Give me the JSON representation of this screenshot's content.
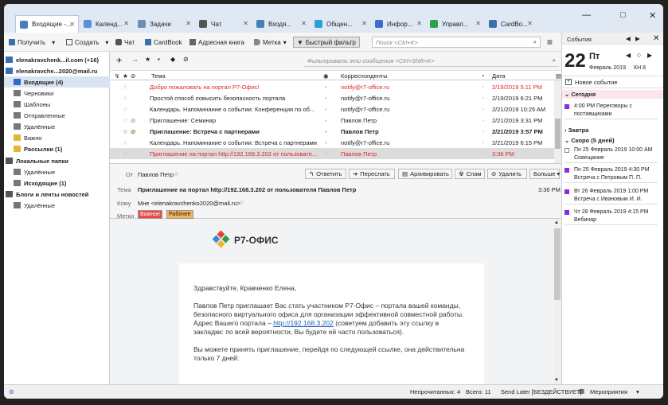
{
  "tabs": [
    {
      "label": "Входящие -...",
      "color": "#4a7ebb"
    },
    {
      "label": "Календ...",
      "color": "#5b8fd6"
    },
    {
      "label": "Задачи",
      "color": "#6d8db3"
    },
    {
      "label": "Чат",
      "color": "#555555"
    },
    {
      "label": "Входя...",
      "color": "#4a7ebb"
    },
    {
      "label": "Общен...",
      "color": "#2aa0d8"
    },
    {
      "label": "Инфор...",
      "color": "#3d6ecf"
    },
    {
      "label": "Управл...",
      "color": "#2e9e4f"
    },
    {
      "label": "CardBo...",
      "color": "#3a6fb0"
    }
  ],
  "window_controls": {
    "minimize": "—",
    "maximize": "□",
    "close": "✕"
  },
  "toolbar": {
    "receive": "Получить",
    "compose": "Создать",
    "chat": "Чат",
    "cardbook": "CardBook",
    "addressbook": "Адресная книга",
    "tag": "Метка",
    "quickfilter": "Быстрый фильтр",
    "search_placeholder": "Поиск <Ctrl+K>"
  },
  "filter_placeholder": "Фильтровать эти сообщения <Ctrl+Shift+K>",
  "folders": [
    {
      "label": "elenakravchenk...il.com (+16)",
      "bold": true
    },
    {
      "label": "elenakravche...2020@mail.ru",
      "bold": true
    },
    {
      "label": "Входящие (4)",
      "bold": true
    },
    {
      "label": "Черновики",
      "bold": false
    },
    {
      "label": "Шаблоны",
      "bold": false
    },
    {
      "label": "Отправленные",
      "bold": false
    },
    {
      "label": "Удалённые",
      "bold": false
    },
    {
      "label": "Важно",
      "bold": false
    },
    {
      "label": "Рассылки (1)",
      "bold": true
    },
    {
      "label": "Локальные папки",
      "bold": true
    },
    {
      "label": "Удалённые",
      "bold": false
    },
    {
      "label": "Исходящие (1)",
      "bold": true
    },
    {
      "label": "Блоги и ленты новостей",
      "bold": true
    },
    {
      "label": "Удалённые",
      "bold": false
    }
  ],
  "list_headers": {
    "subject": "Тема",
    "correspondent": "Корреспонденты",
    "date": "Дата"
  },
  "messages": [
    {
      "subject": "Добро пожаловать на портал Р7-Офис!",
      "from": "notify@r7-office.ru",
      "date": "2/19/2019 5:11 PM",
      "red": true,
      "bold": false,
      "sel": false
    },
    {
      "subject": "Простой способ повысить безопасность портала",
      "from": "notify@r7-office.ru",
      "date": "2/19/2019 6:21 PM",
      "red": false,
      "bold": false,
      "sel": false
    },
    {
      "subject": "Календарь. Напоминание о событии: Конференция по об...",
      "from": "notify@r7-office.ru",
      "date": "2/21/2019 10:25 AM",
      "red": false,
      "bold": false,
      "sel": false
    },
    {
      "subject": "Приглашение: Семинар",
      "from": "Павлов Петр",
      "date": "2/21/2019 3:31 PM",
      "red": false,
      "bold": false,
      "sel": false
    },
    {
      "subject": "Приглашение: Встреча с партнерами",
      "from": "Павлов Петр",
      "date": "2/21/2019 3:57 PM",
      "red": false,
      "bold": true,
      "sel": false
    },
    {
      "subject": "Календарь. Напоминание о событии: Встреча с партнерами",
      "from": "notify@r7-office.ru",
      "date": "2/21/2019 6:15 PM",
      "red": false,
      "bold": false,
      "sel": false
    },
    {
      "subject": "Приглашение на портал http://192.168.3.202 от пользовате...",
      "from": "Павлов Петр",
      "date": "3:36 PM",
      "red": true,
      "bold": false,
      "sel": true
    }
  ],
  "header": {
    "from_label": "От",
    "from": "Павлов Петр",
    "subject_label": "Тема",
    "subject": "Приглашение на портал http://192.168.3.202 от пользователя Павлов Петр",
    "time": "3:36 PM",
    "to_label": "Кому",
    "to": "Мне <elenakravchenko2020@mail.ru>",
    "tags_label": "Метки",
    "tag1": "Важное",
    "tag2": "Рабочее",
    "reply": "Ответить",
    "forward": "Переслать",
    "archive": "Архивировать",
    "spam": "Спам",
    "delete": "Удалить",
    "more": "Больше"
  },
  "body": {
    "logo": "Р7-ОФИС",
    "greeting": "Здравствуйте, Кравченко Елена,",
    "p1a": "Павлов Петр приглашает Вас стать участником Р7-Офис – портала вашей команды, безопасного виртуального офиса для организации эффективной совместной работы. Адрес Вашего портала –",
    "link": "http://192.168.3.202",
    "p1b": "(советуем добавить эту ссылку в закладки: по всей вероятности, Вы будете ей часто пользоваться).",
    "p2": "Вы можете принять приглашение, перейдя по следующей ссылке, она действительна только 7 дней:"
  },
  "sidebar": {
    "title": "События",
    "day": "22",
    "weekday": "Пт",
    "month": "Февраль 2019",
    "week": "КН 8",
    "new_event": "Новое событие",
    "today": "Сегодня",
    "tomorrow": "Завтра",
    "soon": "Скоро (5 дней)",
    "events": [
      {
        "line1": "4:00 PM Переговоры с",
        "line2": "поставщиками"
      },
      {
        "line1": "Пн 25 Февраль 2019 10:00 AM",
        "line2": "Совещание"
      },
      {
        "line1": "Пн 25 Февраль 2019 4:30 PM",
        "line2": "Встреча с Петровым П. П."
      },
      {
        "line1": "Вт 26 Февраль 2019 1:00 PM",
        "line2": "Встреча с Ивановым И. И."
      },
      {
        "line1": "Чт 28 Февраль 2019 4:15 PM",
        "line2": "Вебинар"
      }
    ]
  },
  "status": {
    "unread": "Непрочитанных: 4",
    "total": "Всего: 11",
    "send_later": "Send Later [БЕЗДЕЙСТВУЕТ]",
    "events": "Мероприятия"
  }
}
